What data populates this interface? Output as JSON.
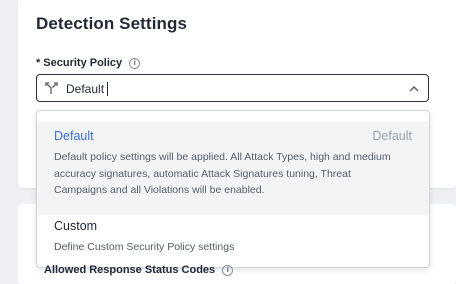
{
  "section": {
    "title": "Detection Settings"
  },
  "security_policy": {
    "label": "Security Policy",
    "required_marker": "*",
    "info_icon": "info-icon",
    "value": "Default",
    "options": [
      {
        "title": "Default",
        "tag": "Default",
        "description": "Default policy settings will be applied. All Attack Types, high and medium accuracy signatures, automatic Attack Signatures tuning, Threat Campaigns and all Violations will be enabled.",
        "selected": true
      },
      {
        "title": "Custom",
        "description": "Define Custom Security Policy settings",
        "selected": false
      }
    ]
  },
  "next_field": {
    "label": "Allowed Response Status Codes"
  },
  "colors": {
    "accent": "#3d6fd8",
    "border_dark": "#2b3140",
    "selected_bg": "#f3f4f6"
  }
}
